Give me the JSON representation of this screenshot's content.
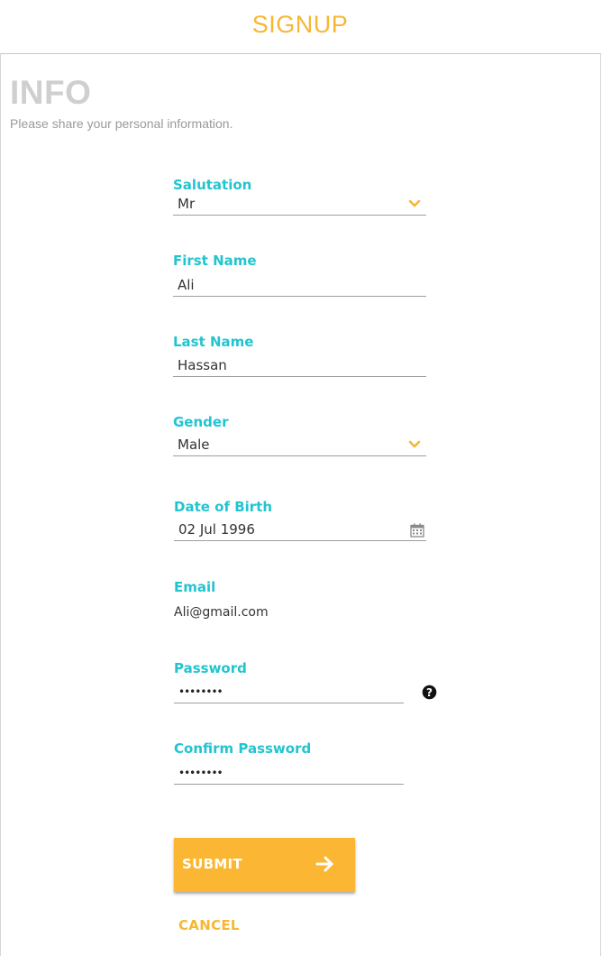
{
  "header": {
    "title": "SIGNUP"
  },
  "section": {
    "title": "INFO",
    "subtitle": "Please share your personal information."
  },
  "form": {
    "salutation": {
      "label": "Salutation",
      "value": "Mr"
    },
    "first_name": {
      "label": "First Name",
      "value": "Ali"
    },
    "last_name": {
      "label": "Last Name",
      "value": "Hassan"
    },
    "gender": {
      "label": "Gender",
      "value": "Male"
    },
    "dob": {
      "label": "Date of Birth",
      "value": "02 Jul 1996"
    },
    "email": {
      "label": "Email",
      "value": "Ali@gmail.com"
    },
    "password": {
      "label": "Password",
      "value": "••••••••"
    },
    "confirm_password": {
      "label": "Confirm Password",
      "value": "••••••••"
    }
  },
  "actions": {
    "submit_label": "SUBMIT",
    "cancel_label": "CANCEL"
  },
  "icons": {
    "dropdown": "chevron-down-icon",
    "calendar": "calendar-icon",
    "help": "question-circle-icon",
    "submit_arrow": "arrow-right-icon"
  },
  "colors": {
    "accent": "#f7b733",
    "label": "#22c4d0",
    "muted_title": "#cfcfcf"
  }
}
